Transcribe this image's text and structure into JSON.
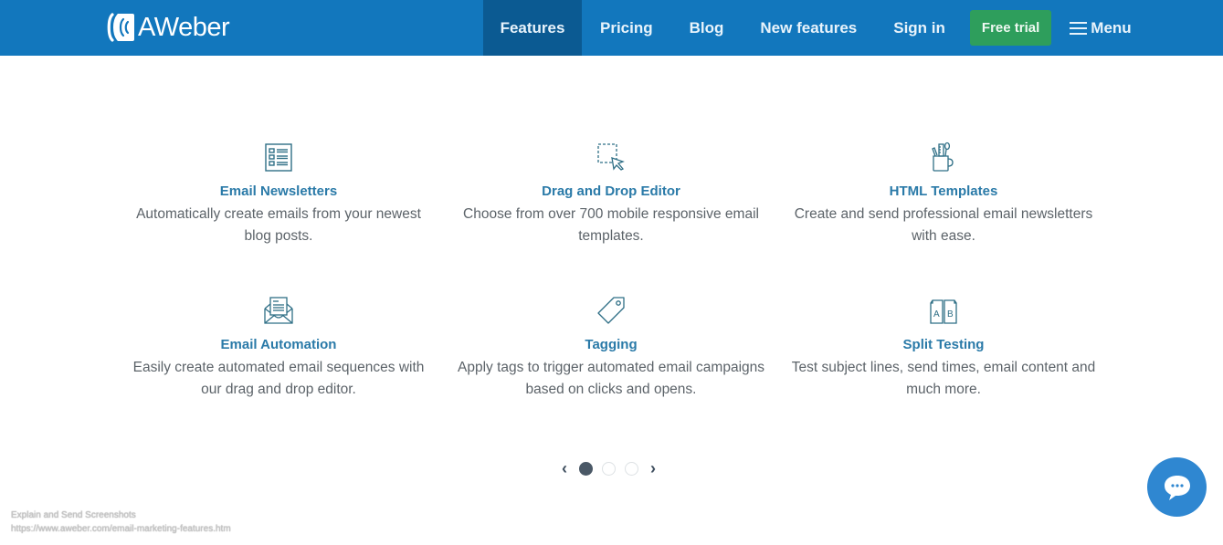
{
  "header": {
    "logo_text": "AWeber",
    "nav": [
      {
        "label": "Features",
        "active": true
      },
      {
        "label": "Pricing",
        "active": false
      },
      {
        "label": "Blog",
        "active": false
      },
      {
        "label": "New features",
        "active": false
      },
      {
        "label": "Sign in",
        "active": false
      }
    ],
    "cta_label": "Free trial",
    "menu_label": "Menu",
    "colors": {
      "bar": "#1277bd",
      "active": "#0b5a92",
      "cta": "#2e9e5c"
    }
  },
  "features": [
    {
      "icon": "newsletter-list-icon",
      "title": "Email Newsletters",
      "description": "Automatically create emails from your newest blog posts."
    },
    {
      "icon": "drag-drop-cursor-icon",
      "title": "Drag and Drop Editor",
      "description": "Choose from over 700 mobile responsive email templates."
    },
    {
      "icon": "pencil-cup-icon",
      "title": "HTML Templates",
      "description": "Create and send professional email newsletters with ease."
    },
    {
      "icon": "open-envelope-icon",
      "title": "Email Automation",
      "description": "Easily create automated email sequences with our drag and drop editor."
    },
    {
      "icon": "tag-icon",
      "title": "Tagging",
      "description": "Apply tags to trigger automated email campaigns based on clicks and opens."
    },
    {
      "icon": "split-ab-icon",
      "title": "Split Testing",
      "description": "Test subject lines, send times, email content and much more."
    }
  ],
  "pager": {
    "prev": "‹",
    "next": "›",
    "pages": 3,
    "current": 1
  },
  "chat": {
    "icon": "chat-bubble-icon",
    "color": "#2f87d1"
  },
  "watermark": {
    "line1": "Explain and Send Screenshots",
    "line2": "https://www.aweber.com/email-marketing-features.htm"
  }
}
